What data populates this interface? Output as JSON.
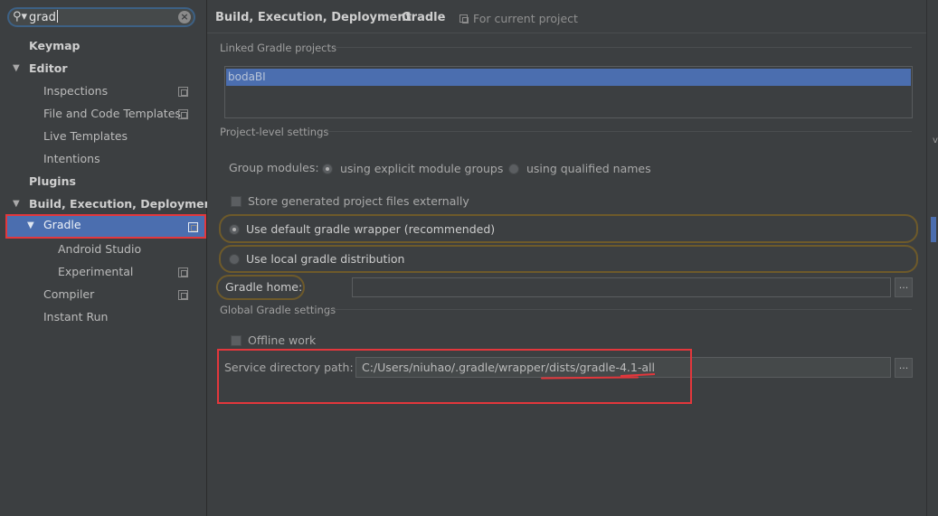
{
  "search": {
    "value": "grad"
  },
  "tree": {
    "keymap": "Keymap",
    "editor": "Editor",
    "inspections": "Inspections",
    "file_templates": "File and Code Templates",
    "live_templates": "Live Templates",
    "intentions": "Intentions",
    "plugins": "Plugins",
    "build": "Build, Execution, Deployment",
    "gradle": "Gradle",
    "android_studio": "Android Studio",
    "experimental": "Experimental",
    "compiler": "Compiler",
    "instant_run": "Instant Run"
  },
  "breadcrumb": {
    "section": "Build, Execution, Deployment",
    "separator": "›",
    "page": "Gradle",
    "scope": "For current project"
  },
  "linked": {
    "title": "Linked Gradle projects",
    "projects": [
      "bodaBI"
    ]
  },
  "project_level": {
    "title": "Project-level settings",
    "group_modules_label": "Group modules:",
    "option_explicit": "using explicit module groups",
    "option_qualified": "using qualified names",
    "store_externally": "Store generated project files externally",
    "use_default_wrapper": "Use default gradle wrapper (recommended)",
    "use_local_distribution": "Use local gradle distribution",
    "gradle_home_label": "Gradle home:",
    "gradle_home_value": ""
  },
  "global": {
    "title": "Global Gradle settings",
    "offline_work": "Offline work",
    "service_dir_label": "Service directory path:",
    "service_dir_value": "C:/Users/niuhao/.gradle/wrapper/dists/gradle-4.1-all"
  },
  "buttons": {
    "browse": "..."
  },
  "colors": {
    "background": "#3c3f41",
    "selection": "#4b6eaf",
    "annotation": "#e3373c"
  }
}
